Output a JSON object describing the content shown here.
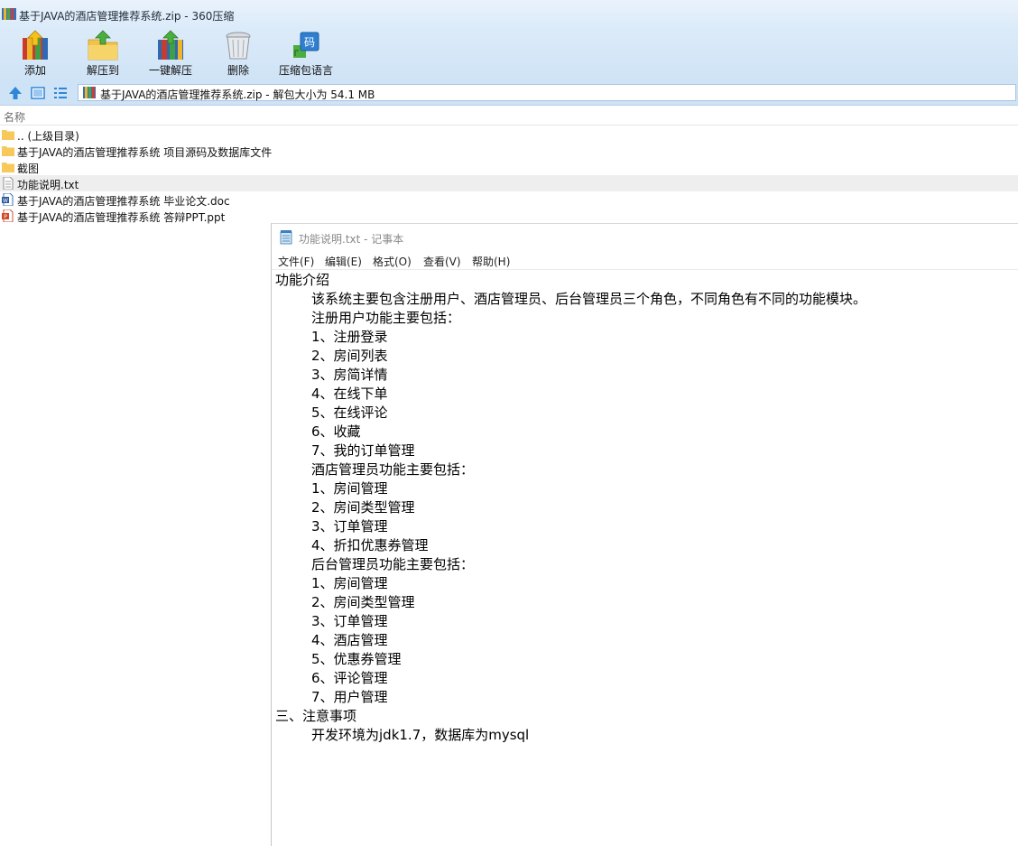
{
  "zip": {
    "title": "基于JAVA的酒店管理推荐系统.zip - 360压缩",
    "toolbar": [
      {
        "label": "添加",
        "icon": "add-icon"
      },
      {
        "label": "解压到",
        "icon": "extract-to-icon"
      },
      {
        "label": "一键解压",
        "icon": "one-click-extract-icon"
      },
      {
        "label": "删除",
        "icon": "delete-icon"
      },
      {
        "label": "压缩包语言",
        "icon": "archive-language-icon"
      }
    ],
    "address": "基于JAVA的酒店管理推荐系统.zip - 解包大小为 54.1 MB",
    "column_name": "名称",
    "files": [
      {
        "name": ".. (上级目录)",
        "type": "folder-icon"
      },
      {
        "name": "基于JAVA的酒店管理推荐系统 项目源码及数据库文件",
        "type": "folder-icon"
      },
      {
        "name": "截图",
        "type": "folder-icon"
      },
      {
        "name": "功能说明.txt",
        "type": "txt-file-icon"
      },
      {
        "name": "基于JAVA的酒店管理推荐系统 毕业论文.doc",
        "type": "doc-file-icon"
      },
      {
        "name": "基于JAVA的酒店管理推荐系统 答辩PPT.ppt",
        "type": "ppt-file-icon"
      }
    ],
    "colors": {
      "title_bg": "#dcebf9",
      "toolbar_bg": "#cfe3f6"
    }
  },
  "notepad": {
    "title": "功能说明.txt - 记事本",
    "menus": [
      "文件(F)",
      "编辑(E)",
      "格式(O)",
      "查看(V)",
      "帮助(H)"
    ],
    "lines": [
      {
        "text": "功能介绍",
        "indent": false
      },
      {
        "text": "该系统主要包含注册用户、酒店管理员、后台管理员三个角色，不同角色有不同的功能模块。",
        "indent": true
      },
      {
        "text": "注册用户功能主要包括：",
        "indent": true
      },
      {
        "text": "1、注册登录",
        "indent": true
      },
      {
        "text": "2、房间列表",
        "indent": true
      },
      {
        "text": "3、房简详情",
        "indent": true
      },
      {
        "text": "4、在线下单",
        "indent": true
      },
      {
        "text": "5、在线评论",
        "indent": true
      },
      {
        "text": "6、收藏",
        "indent": true
      },
      {
        "text": "7、我的订单管理",
        "indent": true
      },
      {
        "text": "酒店管理员功能主要包括：",
        "indent": true
      },
      {
        "text": "1、房间管理",
        "indent": true
      },
      {
        "text": "2、房间类型管理",
        "indent": true
      },
      {
        "text": "3、订单管理",
        "indent": true
      },
      {
        "text": "4、折扣优惠券管理",
        "indent": true
      },
      {
        "text": "后台管理员功能主要包括：",
        "indent": true
      },
      {
        "text": "1、房间管理",
        "indent": true
      },
      {
        "text": "2、房间类型管理",
        "indent": true
      },
      {
        "text": "3、订单管理",
        "indent": true
      },
      {
        "text": "4、酒店管理",
        "indent": true
      },
      {
        "text": "5、优惠券管理",
        "indent": true
      },
      {
        "text": "6、评论管理",
        "indent": true
      },
      {
        "text": "7、用户管理",
        "indent": true
      },
      {
        "text": "三、注意事项",
        "indent": false
      },
      {
        "text": "开发环境为jdk1.7，数据库为mysql",
        "indent": true
      }
    ]
  }
}
